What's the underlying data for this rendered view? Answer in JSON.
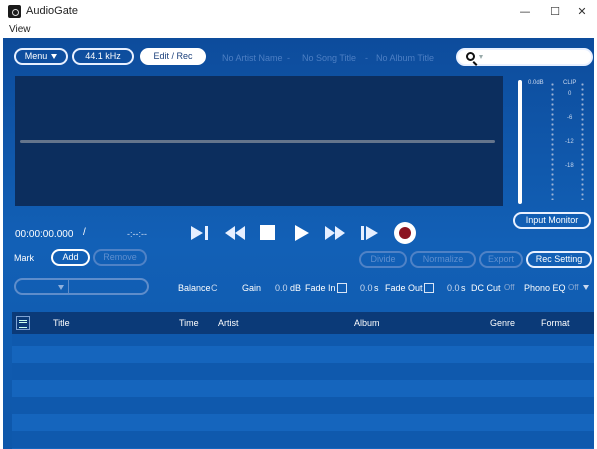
{
  "window": {
    "title": "AudioGate",
    "minimize_glyph": "—",
    "maximize_glyph": "☐",
    "close_glyph": "✕"
  },
  "menubar": {
    "view": "View"
  },
  "toolbar": {
    "menu_label": "Menu",
    "sample_rate": "44.1 kHz",
    "edit_rec_label": "Edit / Rec",
    "artist": "No Artist Name",
    "song": "No Song Title",
    "album": "No Album Title",
    "separator": "-",
    "search_value": ""
  },
  "meter": {
    "db_label": "0.0dB",
    "clip_label": "CLIP",
    "scale": [
      "0",
      "-6",
      "-12",
      "-18"
    ],
    "input_monitor_label": "Input Monitor"
  },
  "transport": {
    "time": "00:00:00.000",
    "time_sep": "/",
    "duration": "-:--:--",
    "icons": [
      "skip-to-start-icon",
      "rewind-icon",
      "stop-icon",
      "play-icon",
      "fast-forward-icon",
      "skip-to-end-icon",
      "record-icon"
    ]
  },
  "marks": {
    "label": "Mark",
    "add_label": "Add",
    "remove_label": "Remove"
  },
  "edit_buttons": {
    "divide": "Divide",
    "normalize": "Normalize",
    "export": "Export",
    "rec_setting": "Rec Setting"
  },
  "params": {
    "balance_label": "Balance",
    "balance_value": "C",
    "gain_label": "Gain",
    "gain_value": "0.0",
    "gain_unit": "dB",
    "fade_in_label": "Fade In",
    "fade_in_checked": false,
    "fade_in_value": "0.0",
    "fade_in_unit": "s",
    "fade_out_label": "Fade Out",
    "fade_out_checked": false,
    "fade_out_value": "0.0",
    "fade_out_unit": "s",
    "dc_cut_label": "DC Cut",
    "dc_cut_value": "Off",
    "phono_eq_label": "Phono EQ",
    "phono_eq_value": "Off"
  },
  "list": {
    "columns": [
      "Title",
      "Time",
      "Artist",
      "Album",
      "Genre",
      "Format"
    ]
  },
  "colors": {
    "app_bg": "#1260b6",
    "waveform_bg": "#0c2e5e",
    "record_red": "#8b1420"
  }
}
